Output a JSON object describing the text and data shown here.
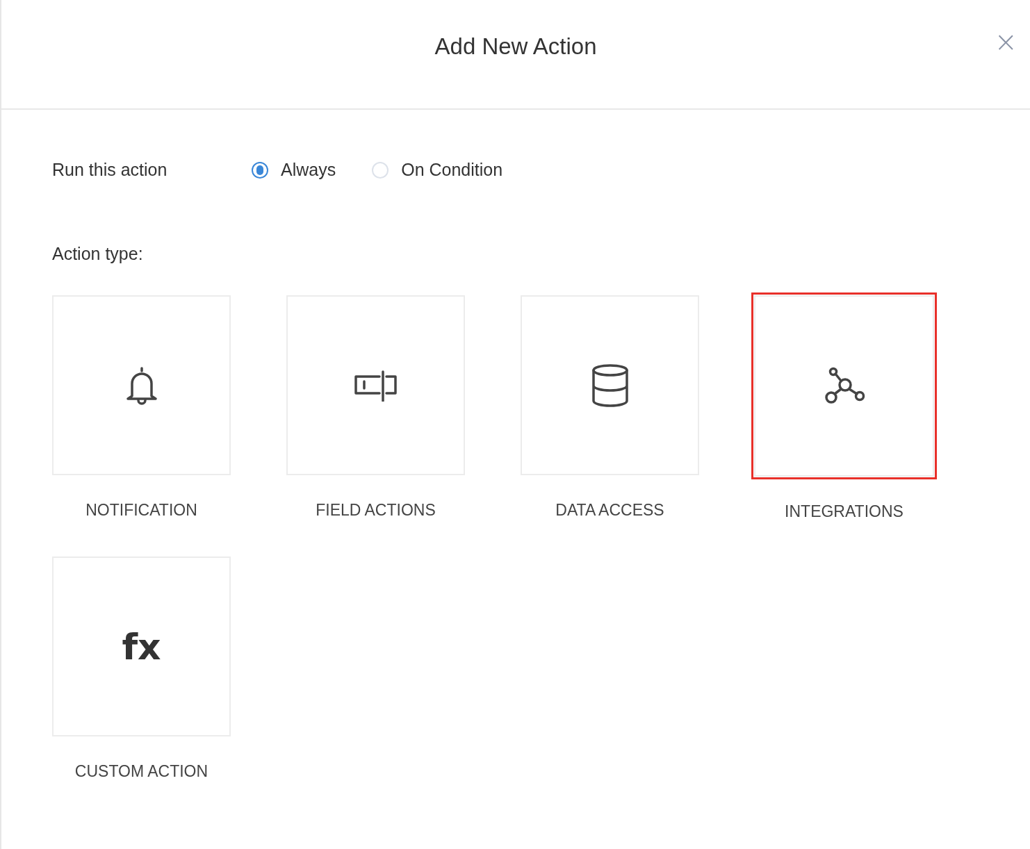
{
  "dialog": {
    "title": "Add New Action",
    "close_glyph": "×"
  },
  "run_option": {
    "label": "Run this action",
    "options": [
      {
        "label": "Always",
        "selected": true
      },
      {
        "label": "On Condition",
        "selected": false
      }
    ]
  },
  "action_type": {
    "label": "Action type:",
    "cards": [
      {
        "kind": "bell",
        "label": "NOTIFICATION",
        "selected": false
      },
      {
        "kind": "field",
        "label": "FIELD ACTIONS",
        "selected": false
      },
      {
        "kind": "database",
        "label": "DATA ACCESS",
        "selected": false
      },
      {
        "kind": "network",
        "label": "INTEGRATIONS",
        "selected": true
      },
      {
        "kind": "glyph",
        "glyph": "fx",
        "label": "CUSTOM ACTION",
        "selected": false
      }
    ]
  }
}
